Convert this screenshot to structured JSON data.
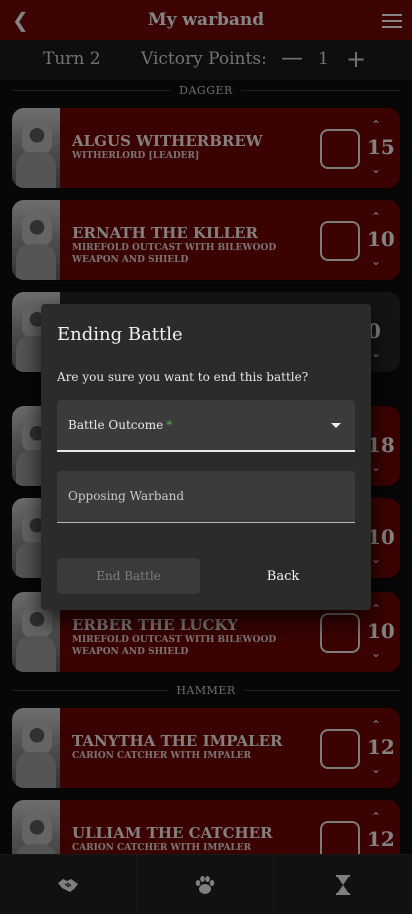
{
  "topbar": {
    "back_icon": "chevron-left-icon",
    "title": "My warband",
    "menu_icon": "hamburger-menu-icon"
  },
  "turnbar": {
    "turn_label": "Turn 2",
    "vp_label": "Victory Points:",
    "vp_minus": "—",
    "vp_value": "1",
    "vp_plus": "+"
  },
  "groups": [
    {
      "label": "DAGGER"
    },
    {
      "label": "HAMMER"
    }
  ],
  "fighters": [
    {
      "name": "ALGUS WITHERBREW",
      "sub": "WITHERLORD [LEADER]",
      "value": "15"
    },
    {
      "name": "ERNATH THE KILLER",
      "sub": "MIREFOLD OUTCAST WITH BILEWOOD WEAPON AND SHIELD",
      "value": "10"
    },
    {
      "name": "",
      "sub": "",
      "value": "0"
    },
    {
      "name": "",
      "sub": "",
      "value": "18"
    },
    {
      "name": "",
      "sub": "",
      "value": "10"
    },
    {
      "name": "ERBER THE LUCKY",
      "sub": "MIREFOLD OUTCAST WITH BILEWOOD WEAPON AND SHIELD",
      "value": "10"
    },
    {
      "name": "TANYTHA THE IMPALER",
      "sub": "CARION CATCHER WITH IMPALER",
      "value": "12"
    },
    {
      "name": "ULLIAM THE CATCHER",
      "sub": "CARION CATCHER WITH IMPALER",
      "value": "12"
    }
  ],
  "dialog": {
    "title": "Ending Battle",
    "message": "Are you sure you want to end this battle?",
    "outcome_label": "Battle Outcome",
    "required_mark": "*",
    "opposing_label": "Opposing Warband",
    "end_button": "End Battle",
    "back_button": "Back"
  },
  "bottomnav": [
    {
      "icon": "handshake-icon"
    },
    {
      "icon": "paw-icon"
    },
    {
      "icon": "hourglass-icon"
    }
  ],
  "colors": {
    "primary": "#6e0a07",
    "card": "#6b0705",
    "required": "#4caf50"
  }
}
